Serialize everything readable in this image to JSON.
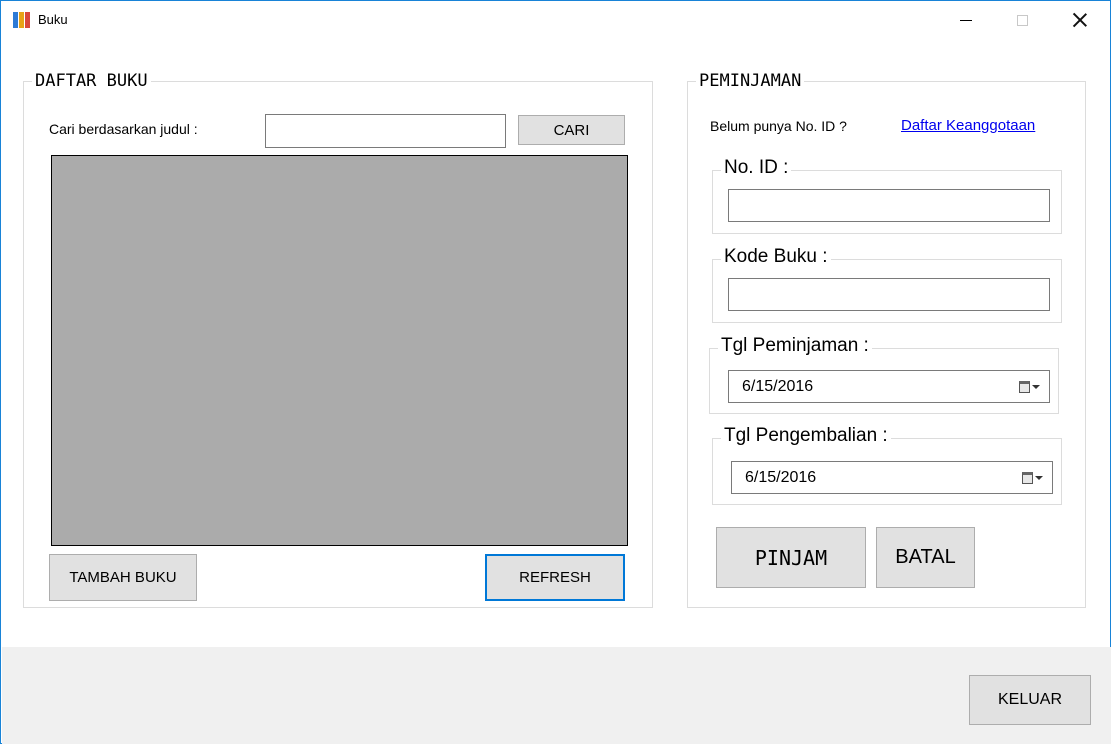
{
  "window": {
    "title": "Buku",
    "icon": "books-icon",
    "accent_color": "#1883d7"
  },
  "daftar_buku": {
    "group_title": "DAFTAR BUKU",
    "search_label": "Cari berdasarkan judul :",
    "search_value": "",
    "search_button": "CARI",
    "grid_background": "#ababab",
    "add_button": "TAMBAH BUKU",
    "refresh_button": "REFRESH"
  },
  "peminjaman": {
    "group_title": "PEMINJAMAN",
    "member_prompt": "Belum punya No. ID ?",
    "member_link": "Daftar Keanggotaan",
    "no_id": {
      "label": "No. ID :",
      "value": ""
    },
    "kode_buku": {
      "label": "Kode Buku :",
      "value": ""
    },
    "tgl_peminjaman": {
      "label": "Tgl Peminjaman :",
      "value": "6/15/2016"
    },
    "tgl_pengembalian": {
      "label": "Tgl Pengembalian :",
      "value": "6/15/2016"
    },
    "pinjam_button": "PINJAM",
    "batal_button": "BATAL"
  },
  "footer": {
    "exit_button": "KELUAR"
  }
}
